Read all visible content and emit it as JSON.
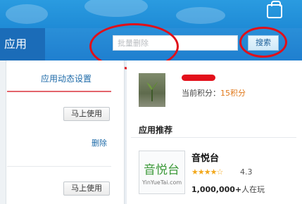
{
  "header": {
    "app_title": "应用",
    "search_placeholder": "批量删除",
    "search_button": "搜索"
  },
  "left_panel": {
    "settings_link": "应用动态设置",
    "use_button_1": "马上使用",
    "delete_link": "删除",
    "use_button_2": "马上使用"
  },
  "profile": {
    "points_label": "当前积分：",
    "points_value": "15积分"
  },
  "recommend": {
    "section_title": "应用推荐",
    "app": {
      "name": "音悦台",
      "icon_text": "音悦台",
      "icon_subtext": "YinYueTai.com",
      "rating": "4.3",
      "stars": "★★★★☆",
      "users_count": "1,000,000+",
      "users_suffix": "人在玩"
    }
  },
  "colors": {
    "header_blue": "#1f7fcf",
    "annotation_red": "#e0101a",
    "link_blue": "#1d6aa8",
    "points_orange": "#e0781a",
    "star_gold": "#f2a81c"
  },
  "icons": [
    "tv-icon",
    "avatar-image",
    "app-icon-yinyuetai"
  ]
}
